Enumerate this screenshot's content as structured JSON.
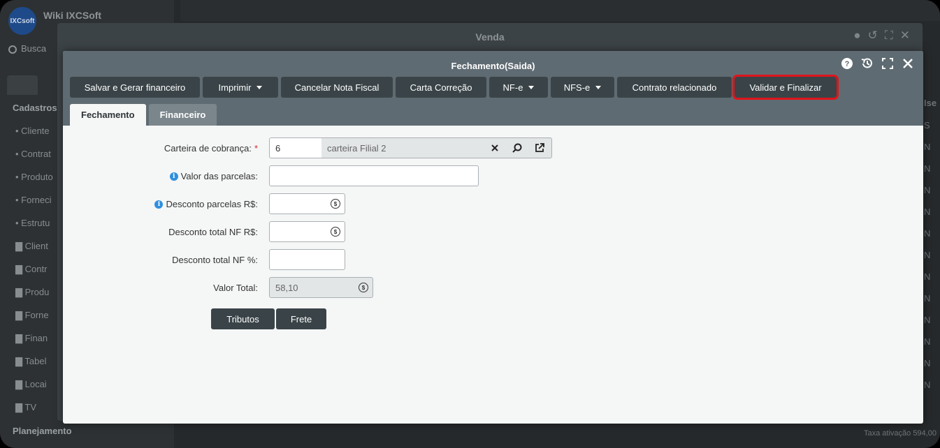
{
  "background": {
    "app_name": "Wiki IXCSoft",
    "logo_text": "IXCsoft",
    "search_placeholder": "Busca",
    "section_cadastros": "Cadastros",
    "items": [
      "Cliente",
      "Contrat",
      "Produto",
      "Forneci",
      "Estrutu",
      "Client",
      "Contr",
      "Produ",
      "Forne",
      "Finan",
      "Tabel",
      "Locai",
      "TV"
    ],
    "section_planejamento": "Planejamento",
    "right_col": [
      "Ise",
      "S",
      "N",
      "N",
      "N",
      "N",
      "N",
      "N",
      "N",
      "N",
      "N",
      "N",
      "N",
      "N"
    ],
    "footer": "Taxa ativação  594,00"
  },
  "venda_window": {
    "title": "Venda"
  },
  "dialog": {
    "title": "Fechamento(Saida)",
    "toolbar": {
      "salvar": "Salvar e Gerar financeiro",
      "imprimir": "Imprimir",
      "cancelar_nf": "Cancelar Nota Fiscal",
      "carta_correcao": "Carta Correção",
      "nfe": "NF-e",
      "nfse": "NFS-e",
      "contrato": "Contrato relacionado",
      "validar": "Validar e Finalizar"
    },
    "tabs": {
      "fechamento": "Fechamento",
      "financeiro": "Financeiro"
    },
    "form": {
      "carteira_label": "Carteira de cobrança:",
      "carteira_required": "*",
      "carteira_id": "6",
      "carteira_desc": "carteira Filial 2",
      "valor_parcelas_label": "Valor das parcelas:",
      "valor_parcelas_value": "",
      "desconto_parcelas_label": "Desconto parcelas R$:",
      "desconto_parcelas_value": "",
      "desconto_total_nf_rs_label": "Desconto total NF R$:",
      "desconto_total_nf_rs_value": "",
      "desconto_total_nf_pct_label": "Desconto total NF %:",
      "desconto_total_nf_pct_value": "",
      "valor_total_label": "Valor Total:",
      "valor_total_value": "58,10"
    },
    "buttons": {
      "tributos": "Tributos",
      "frete": "Frete"
    }
  },
  "colors": {
    "header": "#5f6b72",
    "button": "#3a4448",
    "highlight": "#e0141b",
    "info": "#2f8fdd"
  }
}
